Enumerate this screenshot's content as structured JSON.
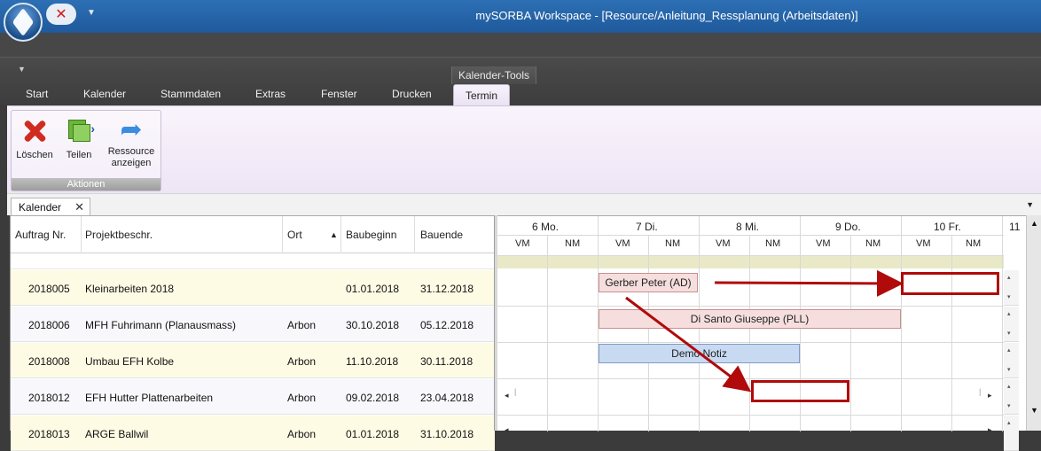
{
  "window": {
    "title": "mySORBA Workspace - [Resource/Anleitung_Ressplanung (Arbeitsdaten)]"
  },
  "ribbon": {
    "context_label": "Kalender-Tools",
    "tabs": [
      {
        "label": "Start"
      },
      {
        "label": "Kalender"
      },
      {
        "label": "Stammdaten"
      },
      {
        "label": "Extras"
      },
      {
        "label": "Fenster"
      },
      {
        "label": "Drucken"
      },
      {
        "label": "Termin"
      }
    ],
    "active_tab": "Termin",
    "group": {
      "label": "Aktionen",
      "buttons": [
        {
          "label": "Löschen",
          "icon": "delete-x-icon"
        },
        {
          "label": "Teilen",
          "icon": "split-icon"
        },
        {
          "label": "Ressource anzeigen",
          "label_line1": "Ressource",
          "label_line2": "anzeigen",
          "icon": "arrow-right-icon"
        }
      ]
    }
  },
  "doc_tab": {
    "label": "Kalender",
    "close": "✕",
    "menu": "▼"
  },
  "grid": {
    "columns": [
      "Auftrag Nr.",
      "Projektbeschr.",
      "Ort",
      "Baubeginn",
      "Bauende"
    ],
    "sort_indicator": "▲",
    "rows": [
      {
        "nr": "2018005",
        "desc": "Kleinarbeiten 2018",
        "ort": "",
        "begin": "01.01.2018",
        "end": "31.12.2018"
      },
      {
        "nr": "2018006",
        "desc": "MFH Fuhrimann (Planausmass)",
        "ort": "Arbon",
        "begin": "30.10.2018",
        "end": "05.12.2018"
      },
      {
        "nr": "2018008",
        "desc": "Umbau EFH Kolbe",
        "ort": "Arbon",
        "begin": "11.10.2018",
        "end": "30.11.2018"
      },
      {
        "nr": "2018012",
        "desc": "EFH Hutter Plattenarbeiten",
        "ort": "Arbon",
        "begin": "09.02.2018",
        "end": "23.04.2018"
      },
      {
        "nr": "2018013",
        "desc": "ARGE Ballwil",
        "ort": "Arbon",
        "begin": "01.01.2018",
        "end": "31.10.2018"
      }
    ]
  },
  "calendar": {
    "days": [
      "6 Mo.",
      "7 Di.",
      "8 Mi.",
      "9 Do.",
      "10 Fr.",
      "11"
    ],
    "halves": [
      "VM",
      "NM"
    ],
    "events": [
      {
        "label": "Gerber Peter (AD)",
        "color": "#f6dede"
      },
      {
        "label": "Di Santo Giuseppe (PLL)",
        "color": "#f6dede"
      },
      {
        "label": "Demo Notiz",
        "color": "#c8daf2"
      }
    ],
    "annotation_color": "#b00a0a"
  },
  "icons": {
    "scroll_up": "▲",
    "scroll_down": "▼",
    "scroll_left": "◂",
    "scroll_right": "▸",
    "small_up": "▴",
    "small_down": "▾"
  }
}
